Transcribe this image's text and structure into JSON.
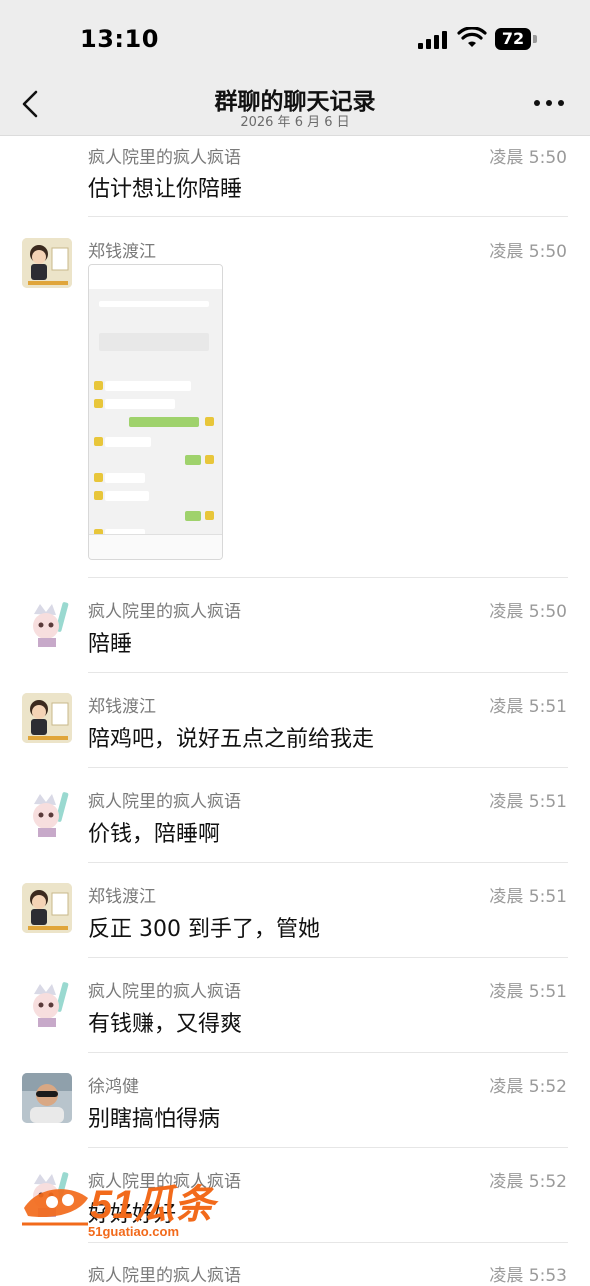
{
  "status_bar": {
    "time": "13:10",
    "battery": "72"
  },
  "nav": {
    "title": "群聊的聊天记录",
    "subtitle": "2026 年 6 月 6 日"
  },
  "messages": [
    {
      "sender": "疯人院里的疯人疯语",
      "time": "凌晨 5:50",
      "text": "估计想让你陪睡"
    },
    {
      "sender": "郑钱渡江",
      "time": "凌晨 5:50",
      "text": ""
    },
    {
      "sender": "疯人院里的疯人疯语",
      "time": "凌晨 5:50",
      "text": "陪睡"
    },
    {
      "sender": "郑钱渡江",
      "time": "凌晨 5:51",
      "text": "陪鸡吧，说好五点之前给我走"
    },
    {
      "sender": "疯人院里的疯人疯语",
      "time": "凌晨 5:51",
      "text": "价钱，陪睡啊"
    },
    {
      "sender": "郑钱渡江",
      "time": "凌晨 5:51",
      "text": "反正 300 到手了，管她"
    },
    {
      "sender": "疯人院里的疯人疯语",
      "time": "凌晨 5:51",
      "text": "有钱赚，又得爽"
    },
    {
      "sender": "徐鸿健",
      "time": "凌晨 5:52",
      "text": "别瞎搞怕得病"
    },
    {
      "sender": "疯人院里的疯人疯语",
      "time": "凌晨 5:52",
      "text": "好好好好"
    },
    {
      "sender": "疯人院里的疯人疯语",
      "time": "凌晨 5:53",
      "text": ""
    }
  ],
  "watermark": {
    "brand": "51瓜条",
    "url": "51guatiao.com"
  },
  "colors": {
    "bar_bg": "#ededed",
    "watermark": "#f26a1b"
  }
}
